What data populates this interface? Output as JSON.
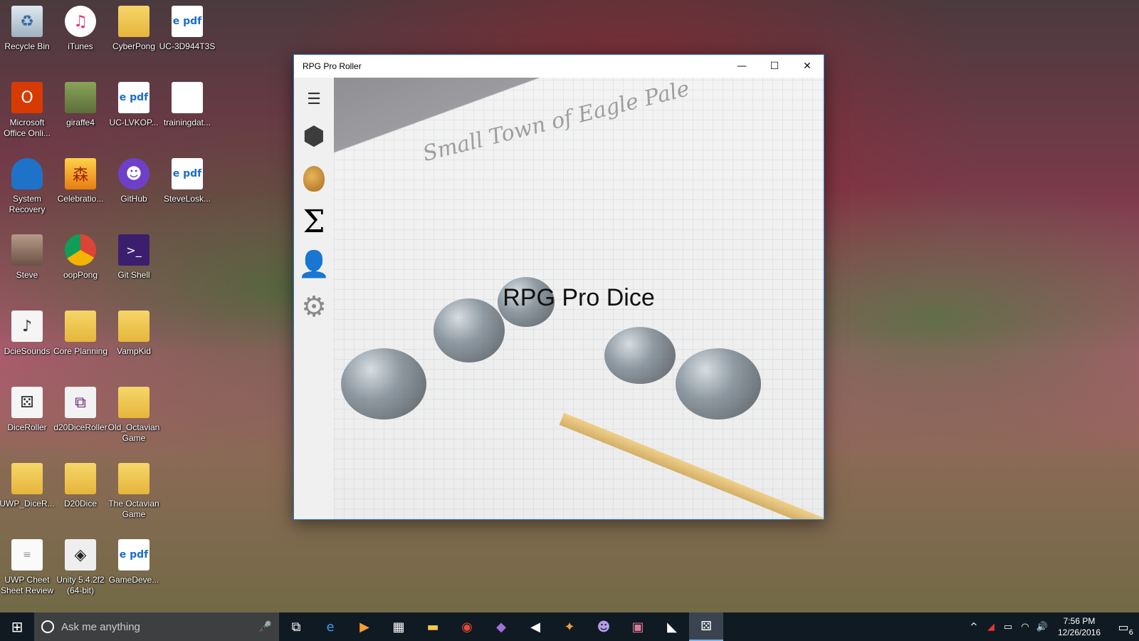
{
  "desktop": {
    "icons": [
      {
        "label": "Recycle Bin",
        "glyph": "♻"
      },
      {
        "label": "iTunes",
        "glyph": "♫"
      },
      {
        "label": "CyberPong",
        "glyph": ""
      },
      {
        "label": "UC-3D944T3S",
        "glyph": "e pdf"
      },
      {
        "label": "Microsoft Office Onli...",
        "glyph": "O"
      },
      {
        "label": "giraffe4",
        "glyph": ""
      },
      {
        "label": "UC-LVKOP...",
        "glyph": "e pdf"
      },
      {
        "label": "trainingdat...",
        "glyph": ""
      },
      {
        "label": "System Recovery",
        "glyph": ""
      },
      {
        "label": "Celebratio...",
        "glyph": "森"
      },
      {
        "label": "GitHub",
        "glyph": "☻"
      },
      {
        "label": "SteveLosk...",
        "glyph": "e pdf"
      },
      {
        "label": "Steve",
        "glyph": ""
      },
      {
        "label": "oopPong",
        "glyph": ""
      },
      {
        "label": "Git Shell",
        "glyph": ">_"
      },
      {
        "label": "DcieSounds",
        "glyph": "♪"
      },
      {
        "label": "Core Planning",
        "glyph": ""
      },
      {
        "label": "VampKid",
        "glyph": ""
      },
      {
        "label": "DiceRoller",
        "glyph": "⚄"
      },
      {
        "label": "d20DiceRoller",
        "glyph": "⧉"
      },
      {
        "label": "Old_Octavian Game",
        "glyph": ""
      },
      {
        "label": "UWP_DiceR...",
        "glyph": ""
      },
      {
        "label": "D20Dice",
        "glyph": ""
      },
      {
        "label": "The Octavian Game",
        "glyph": ""
      },
      {
        "label": "UWP Cheet Sheet Review",
        "glyph": "≡"
      },
      {
        "label": "Unity 5.4.2f2 (64-bit)",
        "glyph": "◈"
      },
      {
        "label": "GameDeve...",
        "glyph": "e pdf"
      }
    ]
  },
  "window": {
    "title": "RPG Pro Roller",
    "minimize": "—",
    "maximize": "☐",
    "close": "✕",
    "nav": {
      "menu": "☰",
      "dice": "⬢",
      "sigma": "Σ",
      "user": "👤",
      "settings": "⚙"
    },
    "content_title": "RPG Pro Dice",
    "sketch_text": "Small Town of Eagle Pale"
  },
  "taskbar": {
    "start": "⊞",
    "search_placeholder": "Ask me anything",
    "mic": "🎤",
    "apps": [
      "⧉",
      "e",
      "▶",
      "▦",
      "▬",
      "◉",
      "◆",
      "◀",
      "✦",
      "☻",
      "▣",
      "◣",
      "⚄"
    ],
    "tray": [
      "^",
      "◢",
      "▭",
      "◠",
      "🔊"
    ],
    "time": "7:56 PM",
    "date": "12/26/2016",
    "notifications": "6"
  },
  "colors": {
    "accent": "#2b78c5",
    "taskbar": "#101a22"
  }
}
